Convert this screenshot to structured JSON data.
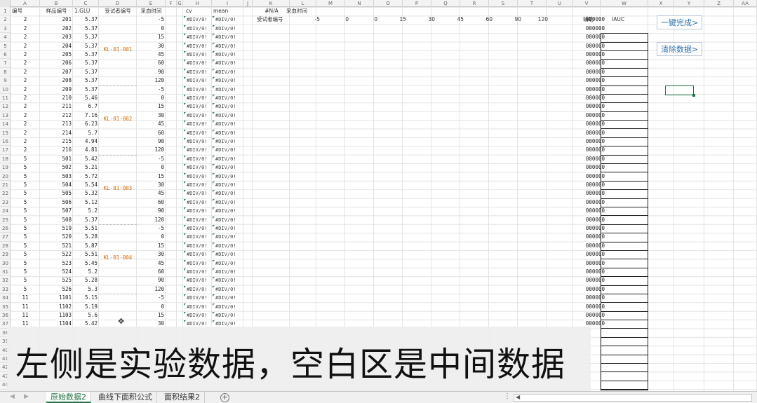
{
  "columns": [
    "A",
    "B",
    "C",
    "D",
    "E",
    "F",
    "G",
    "H",
    "I",
    "J",
    "K",
    "L",
    "M",
    "N",
    "O",
    "P",
    "Q",
    "R",
    "S",
    "T",
    "U",
    "V",
    "W",
    "X",
    "Y",
    "Z",
    "AA"
  ],
  "headers": {
    "A": "编号",
    "B": "样品编号",
    "C": "1.GLU",
    "D": "受试者编号",
    "E": "采血时间",
    "H": "cv",
    "I": "mean",
    "K": "#N/A",
    "L": "采血时间",
    "K2": "受试者编号",
    "V": "辅助",
    "W": "IAUC"
  },
  "time_points": [
    "-5",
    "0",
    "0",
    "15",
    "30",
    "45",
    "60",
    "90",
    "120"
  ],
  "rows": [
    {
      "a": "2",
      "b": "201",
      "c": "5.37",
      "e": "-5"
    },
    {
      "a": "2",
      "b": "202",
      "c": "5.37",
      "e": "0"
    },
    {
      "a": "2",
      "b": "203",
      "c": "5.37",
      "e": "15"
    },
    {
      "a": "2",
      "b": "204",
      "c": "5.37",
      "e": "30"
    },
    {
      "a": "2",
      "b": "205",
      "c": "5.37",
      "e": "45"
    },
    {
      "a": "2",
      "b": "206",
      "c": "5.37",
      "e": "60"
    },
    {
      "a": "2",
      "b": "207",
      "c": "5.37",
      "e": "90"
    },
    {
      "a": "2",
      "b": "208",
      "c": "5.37",
      "e": "120"
    },
    {
      "a": "2",
      "b": "209",
      "c": "5.37",
      "e": "-5"
    },
    {
      "a": "2",
      "b": "210",
      "c": "5.46",
      "e": "0"
    },
    {
      "a": "2",
      "b": "211",
      "c": "6.7",
      "e": "15"
    },
    {
      "a": "2",
      "b": "212",
      "c": "7.16",
      "e": "30"
    },
    {
      "a": "2",
      "b": "213",
      "c": "6.23",
      "e": "45"
    },
    {
      "a": "2",
      "b": "214",
      "c": "5.7",
      "e": "60"
    },
    {
      "a": "2",
      "b": "215",
      "c": "4.94",
      "e": "90"
    },
    {
      "a": "2",
      "b": "216",
      "c": "4.81",
      "e": "120"
    },
    {
      "a": "5",
      "b": "501",
      "c": "5.42",
      "e": "-5"
    },
    {
      "a": "5",
      "b": "502",
      "c": "5.21",
      "e": "0"
    },
    {
      "a": "5",
      "b": "503",
      "c": "5.72",
      "e": "15"
    },
    {
      "a": "5",
      "b": "504",
      "c": "5.54",
      "e": "30"
    },
    {
      "a": "5",
      "b": "505",
      "c": "5.32",
      "e": "45"
    },
    {
      "a": "5",
      "b": "506",
      "c": "5.12",
      "e": "60"
    },
    {
      "a": "5",
      "b": "507",
      "c": "5.2",
      "e": "90"
    },
    {
      "a": "5",
      "b": "508",
      "c": "5.37",
      "e": "120"
    },
    {
      "a": "5",
      "b": "519",
      "c": "5.51",
      "e": "-5"
    },
    {
      "a": "5",
      "b": "520",
      "c": "5.28",
      "e": "0"
    },
    {
      "a": "5",
      "b": "521",
      "c": "5.87",
      "e": "15"
    },
    {
      "a": "5",
      "b": "522",
      "c": "5.51",
      "e": "30"
    },
    {
      "a": "5",
      "b": "523",
      "c": "5.45",
      "e": "45"
    },
    {
      "a": "5",
      "b": "524",
      "c": "5.2",
      "e": "60"
    },
    {
      "a": "5",
      "b": "525",
      "c": "5.28",
      "e": "90"
    },
    {
      "a": "5",
      "b": "526",
      "c": "5.3",
      "e": "120"
    },
    {
      "a": "11",
      "b": "1101",
      "c": "5.15",
      "e": "-5"
    },
    {
      "a": "11",
      "b": "1102",
      "c": "5.19",
      "e": "0"
    },
    {
      "a": "11",
      "b": "1103",
      "c": "5.6",
      "e": "15"
    },
    {
      "a": "11",
      "b": "1104",
      "c": "5.42",
      "e": "30"
    }
  ],
  "subjects": [
    "KL-01-001",
    "KL-01-002",
    "KL-01-003",
    "KL-01-004"
  ],
  "error_value": "#DIV/0!",
  "aux_value": "000000",
  "buttons": {
    "complete": "一键完成>",
    "clear": "清除数据>"
  },
  "caption": "左侧是实验数据，空白区是中间数据",
  "sheets": [
    "原始数据2",
    "曲线下面积公式",
    "面积结果2"
  ],
  "active_sheet": "原始数据2",
  "row_count": 44,
  "colors": {
    "subject_text": "#d46b08",
    "button_text": "#2f6fa8",
    "active_tab": "#217346"
  }
}
